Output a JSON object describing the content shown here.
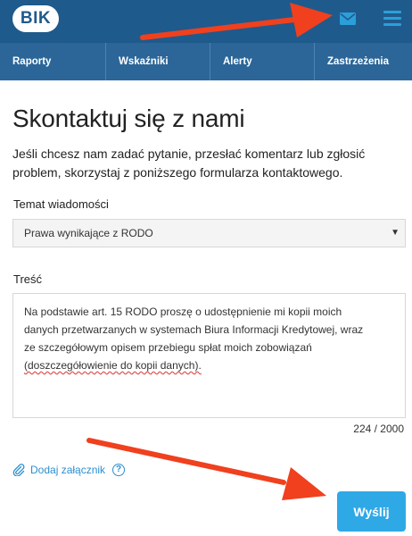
{
  "header": {
    "logo_text": "BIK",
    "icons": [
      "mail-icon",
      "menu-icon"
    ]
  },
  "nav": {
    "items": [
      {
        "label": "Raporty"
      },
      {
        "label": "Wskaźniki"
      },
      {
        "label": "Alerty"
      },
      {
        "label": "Zastrzeżenia"
      }
    ]
  },
  "page": {
    "title": "Skontaktuj się z nami",
    "intro": "Jeśli chcesz nam zadać pytanie, przesłać komentarz lub zgłosić problem, skorzystaj z poniższego formularza kontaktowego."
  },
  "form": {
    "subject_label": "Temat wiadomości",
    "subject_value": "Prawa wynikające z RODO",
    "content_label": "Treść",
    "content_lines": [
      "Na podstawie art. 15 RODO proszę o udostępnienie mi kopii moich",
      "danych przetwarzanych w systemach Biura Informacji Kredytowej, wraz",
      "ze szczegółowym opisem przebiegu spłat moich zobowiązań",
      "(doszczegółowienie do kopii danych)."
    ],
    "char_counter": "224 / 2000",
    "attach_label": "Dodaj załącznik",
    "help_glyph": "?",
    "submit_label": "Wyślij"
  },
  "colors": {
    "header_bg": "#1f5a8c",
    "nav_bg": "#2c6698",
    "accent": "#2fa8e6",
    "annotation_arrow": "#f0401e"
  }
}
